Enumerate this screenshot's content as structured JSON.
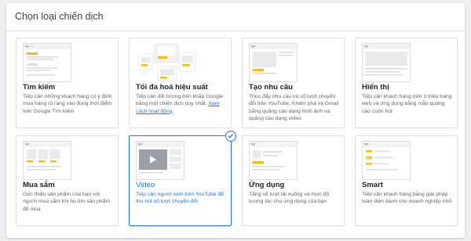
{
  "panel": {
    "title": "Chọn loại chiến dịch"
  },
  "cards": [
    {
      "title": "Tìm kiếm",
      "desc": "Tiếp cận những khách hàng có ý định mua hàng rõ ràng vào đúng thời điểm trên Google Tìm kiếm",
      "icon": "search-ad-thumbnail-icon"
    },
    {
      "title": "Tối đa hoá hiệu suất",
      "desc": "Tiếp cận đối tượng trên khắp Google bằng một chiến dịch duy nhất. ",
      "link": "Xem cách hoạt động",
      "icon": "performance-max-thumbnail-icon"
    },
    {
      "title": "Tạo nhu cầu",
      "desc": "Thúc đẩy nhu cầu và số lượt chuyển đổi trên YouTube, Khám phá và Gmail bằng quảng cáo dạng hình ảnh và quảng cáo dạng video",
      "icon": "demand-gen-thumbnail-icon"
    },
    {
      "title": "Hiển thị",
      "desc": "Tiếp cận khách hàng trên 3 triệu trang web và ứng dụng bằng mẫu quảng cáo cuốn hút",
      "icon": "display-thumbnail-icon"
    },
    {
      "title": "Mua sắm",
      "desc": "Giới thiệu sản phẩm của bạn với người mua sắm khi họ tìm sản phẩm để mua",
      "icon": "shopping-thumbnail-icon"
    },
    {
      "title": "Video",
      "desc": "Tiếp cận người xem trên YouTube để thu hút số lượt chuyển đổi",
      "icon": "video-thumbnail-icon",
      "selected": true
    },
    {
      "title": "Ứng dụng",
      "desc": "Tăng số lượt tải xuống và mức độ tương tác cho ứng dụng của bạn",
      "icon": "app-thumbnail-icon"
    },
    {
      "title": "Smart",
      "desc": "Tiếp cận khách hàng bằng giải pháp toàn diện dành cho doanh nghiệp nhỏ",
      "icon": "smart-thumbnail-icon"
    }
  ],
  "colors": {
    "accent": "#1a73e8",
    "highlight": "#fbbc04"
  }
}
